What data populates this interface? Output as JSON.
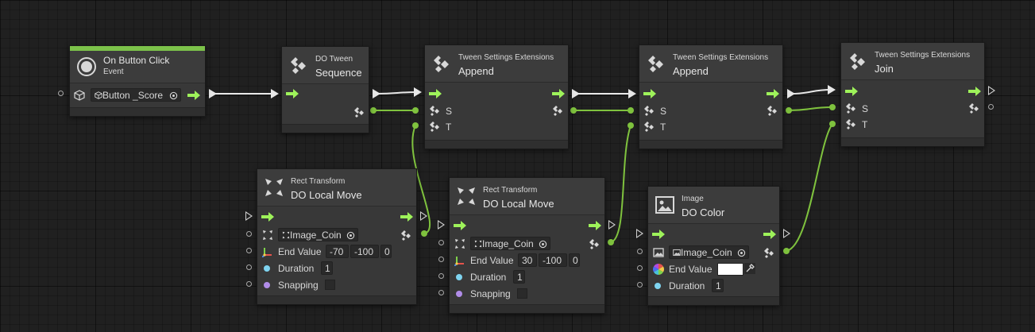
{
  "nodes": {
    "on_button_click": {
      "title": "On Button Click",
      "subtitle": "Event",
      "target": "Button _Score"
    },
    "do_tween_sequence": {
      "subtitle": "DO Tween",
      "title": "Sequence"
    },
    "append1": {
      "subtitle": "Tween Settings Extensions",
      "title": "Append",
      "port_s": "S",
      "port_t": "T"
    },
    "append2": {
      "subtitle": "Tween Settings Extensions",
      "title": "Append",
      "port_s": "S",
      "port_t": "T"
    },
    "join": {
      "subtitle": "Tween Settings Extensions",
      "title": "Join",
      "port_s": "S",
      "port_t": "T"
    },
    "local_move1": {
      "subtitle": "Rect Transform",
      "title": "DO Local Move",
      "target": "Image_Coin",
      "end_value_label": "End Value",
      "x": "-70",
      "y": "-100",
      "z": "0",
      "duration_label": "Duration",
      "duration": "1",
      "snapping_label": "Snapping"
    },
    "local_move2": {
      "subtitle": "Rect Transform",
      "title": "DO Local Move",
      "target": "Image_Coin",
      "end_value_label": "End Value",
      "x": "30",
      "y": "-100",
      "z": "0",
      "duration_label": "Duration",
      "duration": "1",
      "snapping_label": "Snapping"
    },
    "do_color": {
      "subtitle": "Image",
      "title": "DO Color",
      "target": "Image_Coin",
      "end_value_label": "End Value",
      "end_value_color": "#ffffff",
      "duration_label": "Duration",
      "duration": "1"
    }
  },
  "colors": {
    "control_flow": "#9ef25a",
    "value_wire": "#7fc23e",
    "event_bar": "#7cc24a",
    "duration_port": "#7fd4f0",
    "snapping_port": "#b08ce8"
  }
}
